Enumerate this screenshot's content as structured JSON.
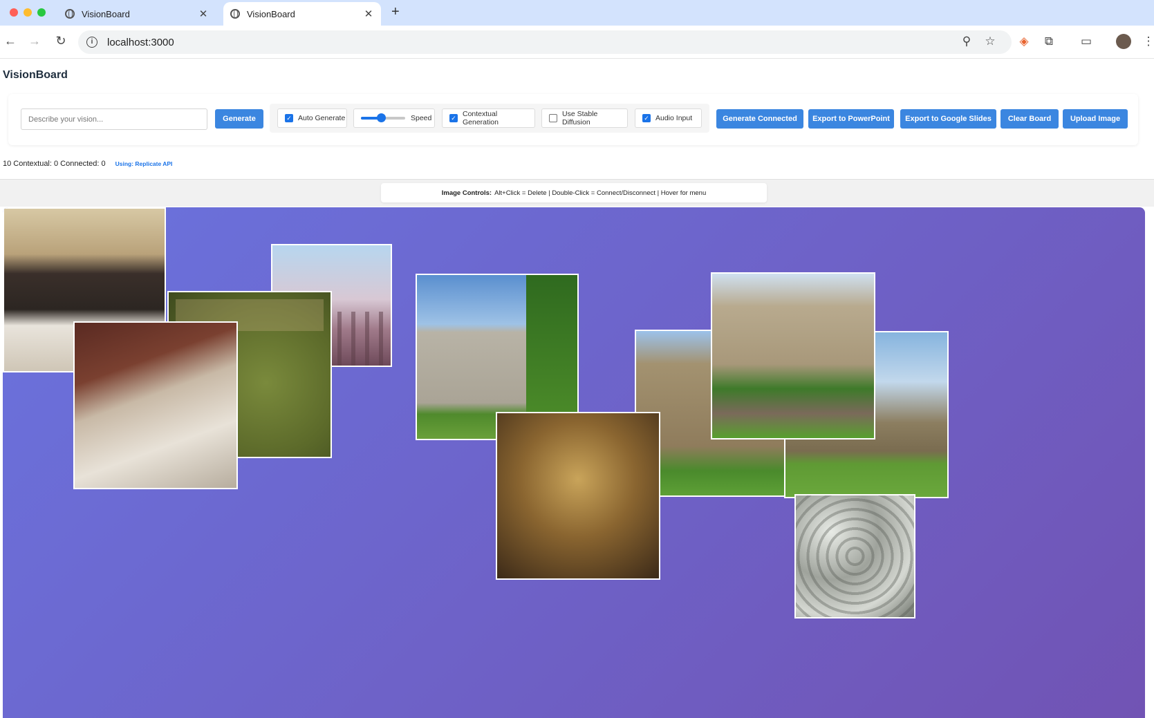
{
  "browser": {
    "tabs": [
      {
        "title": "VisionBoard",
        "active": false
      },
      {
        "title": "VisionBoard",
        "active": true
      }
    ],
    "new_tab_symbol": "+",
    "url": "localhost:3000",
    "icons": [
      "back-arrow-icon",
      "forward-arrow-icon",
      "reload-icon",
      "site-info-icon",
      "zoom-icon",
      "bookmark-star-icon",
      "extension-icon",
      "puzzle-icon",
      "tab-search-icon",
      "profile-avatar",
      "kebab-menu-icon"
    ]
  },
  "app": {
    "title": "VisionBoard",
    "input": {
      "placeholder": "Describe your vision...",
      "value": ""
    },
    "generate_label": "Generate",
    "options": {
      "auto_generate": {
        "label": "Auto Generate",
        "checked": true
      },
      "speed": {
        "label": "Speed",
        "value": 0.45
      },
      "contextual_generation": {
        "label": "Contextual Generation",
        "checked": true
      },
      "stable_diffusion": {
        "label": "Use Stable Diffusion",
        "checked": false
      },
      "audio_input": {
        "label": "Audio Input",
        "checked": true
      }
    },
    "buttons": {
      "generate_connected": "Generate Connected",
      "export_ppt": "Export to PowerPoint",
      "export_slides": "Export to Google Slides",
      "clear_board": "Clear Board",
      "upload_image": "Upload Image"
    },
    "status": {
      "text": "10 Contextual: 0 Connected: 0",
      "api": "Using: Replicate API"
    },
    "image_controls": {
      "label": "Image Controls:",
      "text": "Alt+Click = Delete | Double-Click = Connect/Disconnect | Hover for menu"
    },
    "colors": {
      "accent": "#3b86e0",
      "board_start": "#6a73de",
      "board_end": "#7153b4"
    },
    "board_images": [
      {
        "subject": "wedding-party-photo"
      },
      {
        "subject": "abstract-blurred-image"
      },
      {
        "subject": "vintage-book-cover"
      },
      {
        "subject": "dining-table-setting"
      },
      {
        "subject": "stone-castle-towers"
      },
      {
        "subject": "gothic-castle-facade"
      },
      {
        "subject": "castle-with-lawn"
      },
      {
        "subject": "turreted-chateau"
      },
      {
        "subject": "ornate-mirror-interior"
      },
      {
        "subject": "abstract-lace-pattern"
      }
    ]
  }
}
